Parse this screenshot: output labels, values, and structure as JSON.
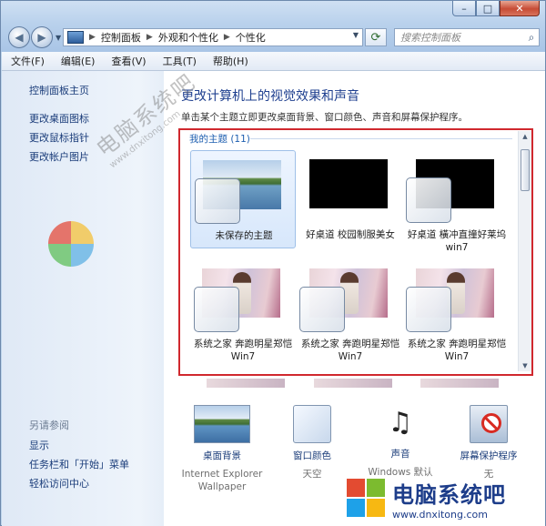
{
  "window": {
    "buttons": {
      "minimize": "–",
      "maximize": "□",
      "close": "✕"
    }
  },
  "nav": {
    "back": "◀",
    "forward": "▶",
    "breadcrumbs": [
      "控制面板",
      "外观和个性化",
      "个性化"
    ],
    "search_placeholder": "搜索控制面板"
  },
  "menu": [
    "文件(F)",
    "编辑(E)",
    "查看(V)",
    "工具(T)",
    "帮助(H)"
  ],
  "sidebar": {
    "home": "控制面板主页",
    "links": [
      "更改桌面图标",
      "更改鼠标指针",
      "更改帐户图片"
    ],
    "see_also_label": "另请参阅",
    "see_also": [
      "显示",
      "任务栏和「开始」菜单",
      "轻松访问中心"
    ]
  },
  "main": {
    "title": "更改计算机上的视觉效果和声音",
    "description": "单击某个主题立即更改桌面背景、窗口颜色、声音和屏幕保护程序。",
    "group_header": "我的主题 (11)",
    "themes": [
      {
        "label": "未保存的主题",
        "thumb": "lake",
        "selected": true
      },
      {
        "label": "好桌道 校园制服美女",
        "thumb": "black",
        "selected": false
      },
      {
        "label": "好桌道 橫冲直撞好莱坞win7",
        "thumb": "black",
        "selected": false
      },
      {
        "label": "系统之家 奔跑明星郑恺Win7",
        "thumb": "blossom",
        "selected": false
      },
      {
        "label": "系统之家 奔跑明星郑恺Win7",
        "thumb": "blossom",
        "selected": false
      },
      {
        "label": "系统之家 奔跑明星郑恺Win7",
        "thumb": "blossom",
        "selected": false
      }
    ]
  },
  "tiles": [
    {
      "name": "桌面背景",
      "value": "Internet Explorer Wallpaper",
      "icon": "wallpaper-icon"
    },
    {
      "name": "窗口颜色",
      "value": "天空",
      "icon": "window-color-icon"
    },
    {
      "name": "声音",
      "value": "Windows 默认",
      "icon": "sound-icon"
    },
    {
      "name": "屏幕保护程序",
      "value": "无",
      "icon": "screensaver-icon"
    }
  ],
  "watermarks": {
    "diagonal_cn": "电脑系统吧",
    "diagonal_en": "www.dnxitong.com",
    "logo_cn": "电脑系统吧",
    "logo_en": "www.dnxitong.com"
  },
  "colors": {
    "link": "#1b3d7a",
    "title": "#1e3f8f",
    "highlight_frame": "#d0282e"
  }
}
